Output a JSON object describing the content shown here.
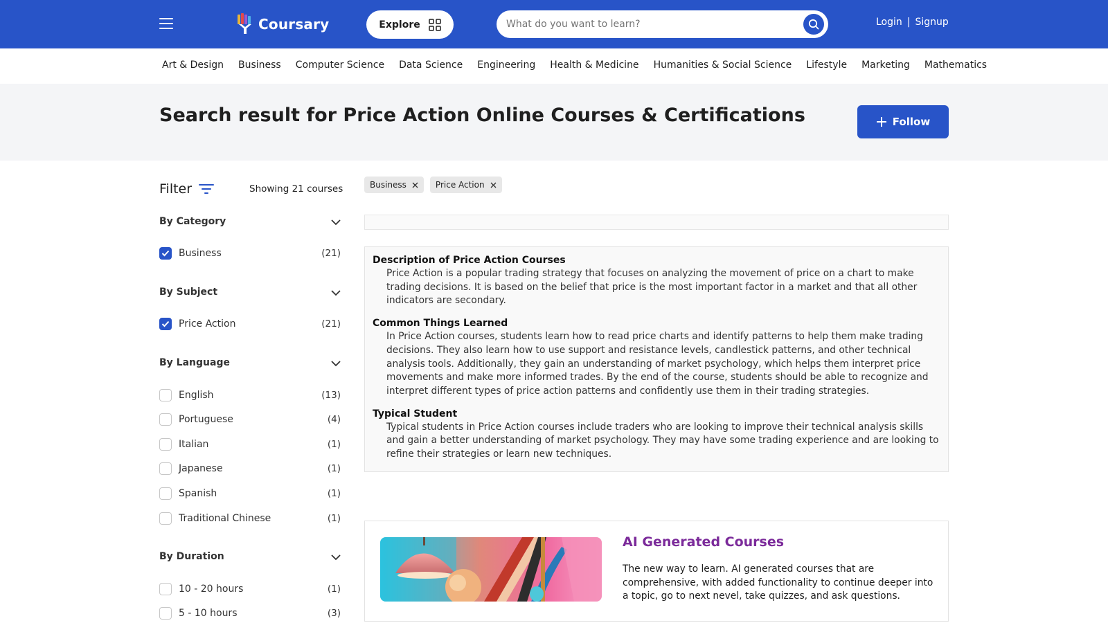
{
  "header": {
    "logo_text": "Coursary",
    "explore_label": "Explore",
    "search_placeholder": "What do you want to learn?",
    "login_label": "Login",
    "auth_separator": "|",
    "signup_label": "Signup"
  },
  "categories": [
    "Art & Design",
    "Business",
    "Computer Science",
    "Data Science",
    "Engineering",
    "Health & Medicine",
    "Humanities & Social Science",
    "Lifestyle",
    "Marketing",
    "Mathematics"
  ],
  "hero": {
    "title_prefix": "Search result for",
    "title_bold": "Price Action Online Courses & Certifications",
    "follow_label": "Follow"
  },
  "filter": {
    "title": "Filter",
    "showing": "Showing 21 courses",
    "category": {
      "title": "By Category",
      "options": [
        {
          "label": "Business",
          "count": "(21)",
          "checked": true
        }
      ]
    },
    "subject": {
      "title": "By Subject",
      "options": [
        {
          "label": "Price Action",
          "count": "(21)",
          "checked": true
        }
      ]
    },
    "language": {
      "title": "By Language",
      "options": [
        {
          "label": "English",
          "count": "(13)",
          "checked": false
        },
        {
          "label": "Portuguese",
          "count": "(4)",
          "checked": false
        },
        {
          "label": "Italian",
          "count": "(1)",
          "checked": false
        },
        {
          "label": "Japanese",
          "count": "(1)",
          "checked": false
        },
        {
          "label": "Spanish",
          "count": "(1)",
          "checked": false
        },
        {
          "label": "Traditional Chinese",
          "count": "(1)",
          "checked": false
        }
      ]
    },
    "duration": {
      "title": "By Duration",
      "options": [
        {
          "label": "10 - 20 hours",
          "count": "(1)",
          "checked": false
        },
        {
          "label": "5 - 10 hours",
          "count": "(3)",
          "checked": false
        }
      ]
    }
  },
  "chips": [
    "Business",
    "Price Action"
  ],
  "description": {
    "sections": [
      {
        "heading": "Description of Price Action Courses",
        "text": "Price Action is a popular trading strategy that focuses on analyzing the movement of price on a chart to make trading decisions. It is based on the belief that price is the most important factor in a market and that all other indicators are secondary."
      },
      {
        "heading": "Common Things Learned",
        "text": "In Price Action courses, students learn how to read price charts and identify patterns to help them make trading decisions. They also learn how to use support and resistance levels, candlestick patterns, and other technical analysis tools. Additionally, they gain an understanding of market psychology, which helps them interpret price movements and make more informed trades. By the end of the course, students should be able to recognize and interpret different types of price action patterns and confidently use them in their trading strategies."
      },
      {
        "heading": "Typical Student",
        "text": "Typical students in Price Action courses include traders who are looking to improve their technical analysis skills and gain a better understanding of market psychology. They may have some trading experience and are looking to refine their strategies or learn new techniques."
      }
    ]
  },
  "ai_card": {
    "title": "AI Generated Courses",
    "text": "The new way to learn. AI generated courses that are comprehensive, with added functionality to continue deeper into a topic, go to next nevel, take quizzes, and ask questions."
  },
  "colors": {
    "brand": "#2854c8",
    "ai_title": "#7b2a9a",
    "hero_bg": "#f4f5f7"
  }
}
